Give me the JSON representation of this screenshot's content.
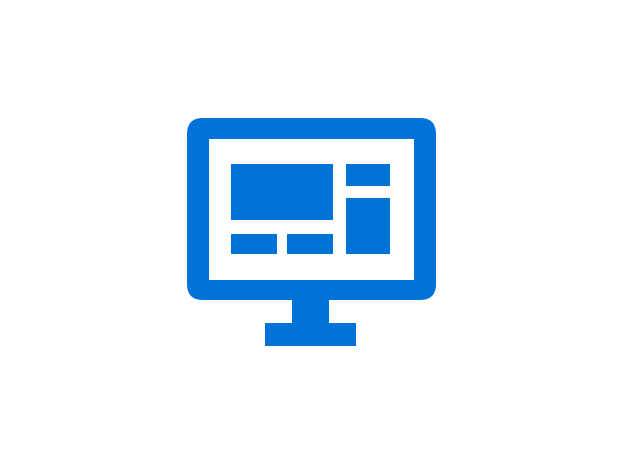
{
  "icon": {
    "name": "desktop-monitor-icon",
    "color": "#0173d8",
    "background": "#ffffff"
  }
}
